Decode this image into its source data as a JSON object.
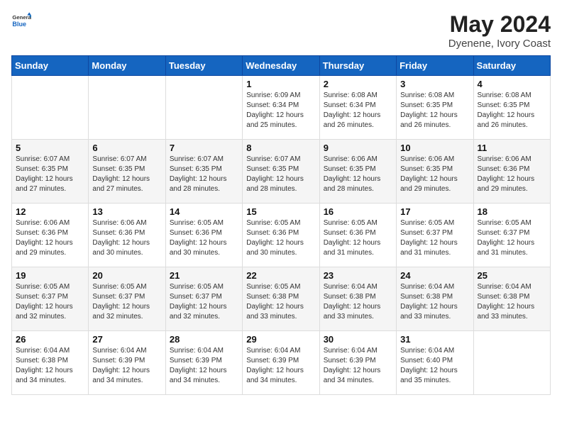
{
  "header": {
    "logo_general": "General",
    "logo_blue": "Blue",
    "title": "May 2024",
    "subtitle": "Dyenene, Ivory Coast"
  },
  "days_of_week": [
    "Sunday",
    "Monday",
    "Tuesday",
    "Wednesday",
    "Thursday",
    "Friday",
    "Saturday"
  ],
  "weeks": [
    [
      {
        "day": "",
        "content": ""
      },
      {
        "day": "",
        "content": ""
      },
      {
        "day": "",
        "content": ""
      },
      {
        "day": "1",
        "content": "Sunrise: 6:09 AM\nSunset: 6:34 PM\nDaylight: 12 hours\nand 25 minutes."
      },
      {
        "day": "2",
        "content": "Sunrise: 6:08 AM\nSunset: 6:34 PM\nDaylight: 12 hours\nand 26 minutes."
      },
      {
        "day": "3",
        "content": "Sunrise: 6:08 AM\nSunset: 6:35 PM\nDaylight: 12 hours\nand 26 minutes."
      },
      {
        "day": "4",
        "content": "Sunrise: 6:08 AM\nSunset: 6:35 PM\nDaylight: 12 hours\nand 26 minutes."
      }
    ],
    [
      {
        "day": "5",
        "content": "Sunrise: 6:07 AM\nSunset: 6:35 PM\nDaylight: 12 hours\nand 27 minutes."
      },
      {
        "day": "6",
        "content": "Sunrise: 6:07 AM\nSunset: 6:35 PM\nDaylight: 12 hours\nand 27 minutes."
      },
      {
        "day": "7",
        "content": "Sunrise: 6:07 AM\nSunset: 6:35 PM\nDaylight: 12 hours\nand 28 minutes."
      },
      {
        "day": "8",
        "content": "Sunrise: 6:07 AM\nSunset: 6:35 PM\nDaylight: 12 hours\nand 28 minutes."
      },
      {
        "day": "9",
        "content": "Sunrise: 6:06 AM\nSunset: 6:35 PM\nDaylight: 12 hours\nand 28 minutes."
      },
      {
        "day": "10",
        "content": "Sunrise: 6:06 AM\nSunset: 6:35 PM\nDaylight: 12 hours\nand 29 minutes."
      },
      {
        "day": "11",
        "content": "Sunrise: 6:06 AM\nSunset: 6:36 PM\nDaylight: 12 hours\nand 29 minutes."
      }
    ],
    [
      {
        "day": "12",
        "content": "Sunrise: 6:06 AM\nSunset: 6:36 PM\nDaylight: 12 hours\nand 29 minutes."
      },
      {
        "day": "13",
        "content": "Sunrise: 6:06 AM\nSunset: 6:36 PM\nDaylight: 12 hours\nand 30 minutes."
      },
      {
        "day": "14",
        "content": "Sunrise: 6:05 AM\nSunset: 6:36 PM\nDaylight: 12 hours\nand 30 minutes."
      },
      {
        "day": "15",
        "content": "Sunrise: 6:05 AM\nSunset: 6:36 PM\nDaylight: 12 hours\nand 30 minutes."
      },
      {
        "day": "16",
        "content": "Sunrise: 6:05 AM\nSunset: 6:36 PM\nDaylight: 12 hours\nand 31 minutes."
      },
      {
        "day": "17",
        "content": "Sunrise: 6:05 AM\nSunset: 6:37 PM\nDaylight: 12 hours\nand 31 minutes."
      },
      {
        "day": "18",
        "content": "Sunrise: 6:05 AM\nSunset: 6:37 PM\nDaylight: 12 hours\nand 31 minutes."
      }
    ],
    [
      {
        "day": "19",
        "content": "Sunrise: 6:05 AM\nSunset: 6:37 PM\nDaylight: 12 hours\nand 32 minutes."
      },
      {
        "day": "20",
        "content": "Sunrise: 6:05 AM\nSunset: 6:37 PM\nDaylight: 12 hours\nand 32 minutes."
      },
      {
        "day": "21",
        "content": "Sunrise: 6:05 AM\nSunset: 6:37 PM\nDaylight: 12 hours\nand 32 minutes."
      },
      {
        "day": "22",
        "content": "Sunrise: 6:05 AM\nSunset: 6:38 PM\nDaylight: 12 hours\nand 33 minutes."
      },
      {
        "day": "23",
        "content": "Sunrise: 6:04 AM\nSunset: 6:38 PM\nDaylight: 12 hours\nand 33 minutes."
      },
      {
        "day": "24",
        "content": "Sunrise: 6:04 AM\nSunset: 6:38 PM\nDaylight: 12 hours\nand 33 minutes."
      },
      {
        "day": "25",
        "content": "Sunrise: 6:04 AM\nSunset: 6:38 PM\nDaylight: 12 hours\nand 33 minutes."
      }
    ],
    [
      {
        "day": "26",
        "content": "Sunrise: 6:04 AM\nSunset: 6:38 PM\nDaylight: 12 hours\nand 34 minutes."
      },
      {
        "day": "27",
        "content": "Sunrise: 6:04 AM\nSunset: 6:39 PM\nDaylight: 12 hours\nand 34 minutes."
      },
      {
        "day": "28",
        "content": "Sunrise: 6:04 AM\nSunset: 6:39 PM\nDaylight: 12 hours\nand 34 minutes."
      },
      {
        "day": "29",
        "content": "Sunrise: 6:04 AM\nSunset: 6:39 PM\nDaylight: 12 hours\nand 34 minutes."
      },
      {
        "day": "30",
        "content": "Sunrise: 6:04 AM\nSunset: 6:39 PM\nDaylight: 12 hours\nand 34 minutes."
      },
      {
        "day": "31",
        "content": "Sunrise: 6:04 AM\nSunset: 6:40 PM\nDaylight: 12 hours\nand 35 minutes."
      },
      {
        "day": "",
        "content": ""
      }
    ]
  ]
}
